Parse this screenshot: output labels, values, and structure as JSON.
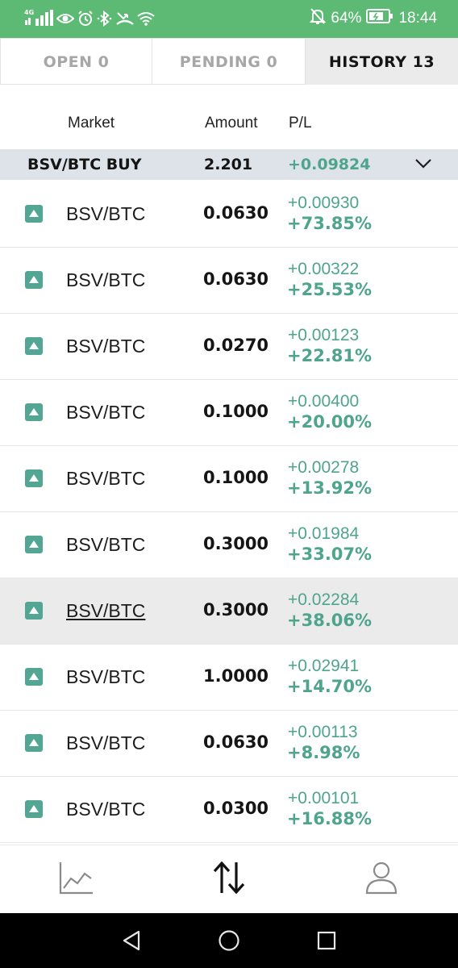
{
  "status_bar": {
    "network_label": "4G",
    "battery": "64%",
    "time": "18:44",
    "background_color": "#5cba74",
    "icons": [
      "signal-icon",
      "eye-icon",
      "alarm-icon",
      "bluetooth-icon",
      "missed-call-icon",
      "wifi-icon",
      "mute-icon",
      "battery-icon"
    ]
  },
  "tabs": [
    {
      "label": "OPEN 0",
      "active": false
    },
    {
      "label": "PENDING 0",
      "active": false
    },
    {
      "label": "HISTORY 13",
      "active": true
    }
  ],
  "columns": {
    "market": "Market",
    "amount": "Amount",
    "pl": "P/L"
  },
  "group": {
    "market": "BSV/BTC BUY",
    "amount": "2.201",
    "pl": "+0.09824",
    "expand_icon": "chevron-down-icon"
  },
  "rows": [
    {
      "market": "BSV/BTC",
      "amount": "0.0630",
      "pl": "+0.00930",
      "pl_percent": "+73.85%"
    },
    {
      "market": "BSV/BTC",
      "amount": "0.0630",
      "pl": "+0.00322",
      "pl_percent": "+25.53%"
    },
    {
      "market": "BSV/BTC",
      "amount": "0.0270",
      "pl": "+0.00123",
      "pl_percent": "+22.81%"
    },
    {
      "market": "BSV/BTC",
      "amount": "0.1000",
      "pl": "+0.00400",
      "pl_percent": "+20.00%"
    },
    {
      "market": "BSV/BTC",
      "amount": "0.1000",
      "pl": "+0.00278",
      "pl_percent": "+13.92%"
    },
    {
      "market": "BSV/BTC",
      "amount": "0.3000",
      "pl": "+0.01984",
      "pl_percent": "+33.07%"
    },
    {
      "market": "BSV/BTC",
      "amount": "0.3000",
      "pl": "+0.02284",
      "pl_percent": "+38.06%",
      "highlighted": true
    },
    {
      "market": "BSV/BTC",
      "amount": "1.0000",
      "pl": "+0.02941",
      "pl_percent": "+14.70%"
    },
    {
      "market": "BSV/BTC",
      "amount": "0.0630",
      "pl": "+0.00113",
      "pl_percent": "+8.98%"
    },
    {
      "market": "BSV/BTC",
      "amount": "0.0300",
      "pl": "+0.00101",
      "pl_percent": "+16.88%"
    }
  ],
  "colors": {
    "accent_green": "#4fa48c",
    "up_badge": "#52a693",
    "group_bg": "#dde3e9",
    "active_tab_bg": "#ebebeb"
  },
  "bottom_nav": [
    {
      "icon": "chart-line-icon"
    },
    {
      "icon": "swap-vertical-icon",
      "active": true
    },
    {
      "icon": "person-icon"
    }
  ],
  "system_nav": [
    "back-icon",
    "home-icon",
    "recents-icon"
  ]
}
